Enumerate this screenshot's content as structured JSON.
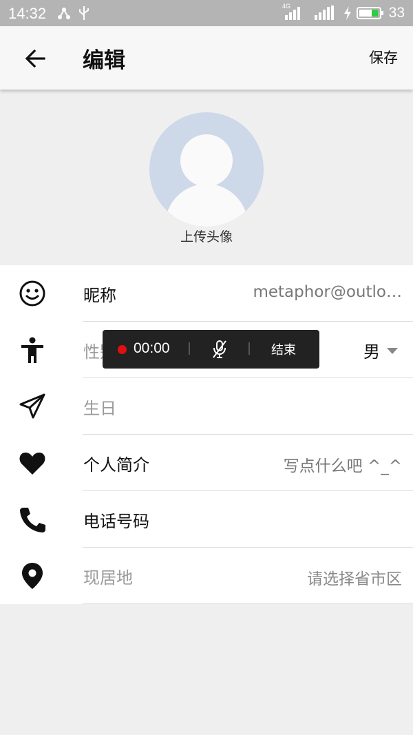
{
  "status_bar": {
    "time": "14:32",
    "network_label": "4G",
    "battery_percent": "33",
    "battery_level": 0.33,
    "icons": [
      "share-icon",
      "usb-icon",
      "signal-icon",
      "charging-icon",
      "battery-icon"
    ]
  },
  "toolbar": {
    "title": "编辑",
    "save_label": "保存",
    "back_icon": "arrow-left-icon"
  },
  "avatar": {
    "upload_label": "上传头像",
    "icon": "default-avatar-icon"
  },
  "profile_fields": [
    {
      "label": "昵称",
      "value": "metaphor@outlo…",
      "icon": "smiley-icon"
    },
    {
      "label": "性别",
      "value": "男",
      "icon": "person-icon"
    },
    {
      "label": "生日",
      "value": "",
      "icon": "paper-plane-icon"
    },
    {
      "label": "个人简介",
      "value": "写点什么吧 ^_^",
      "icon": "heart-icon"
    },
    {
      "label": "电话号码",
      "value": "",
      "icon": "phone-icon"
    },
    {
      "label": "现居地",
      "value": "请选择省市区",
      "icon": "location-pin-icon"
    }
  ],
  "recorder": {
    "timer": "00:00",
    "end_label": "结束",
    "mic_icon": "mic-off-icon"
  },
  "colors": {
    "status_bar": "#b4b4b4",
    "toolbar": "#f7f7f7",
    "background": "#efefef",
    "avatar_bg": "#cdd8e8",
    "record_dot": "#e01010",
    "battery_fill": "#2ecc40"
  }
}
